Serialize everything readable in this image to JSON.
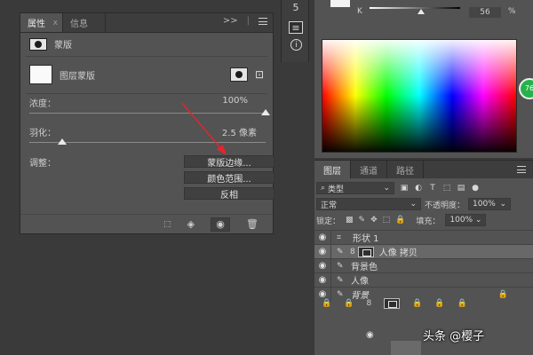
{
  "properties": {
    "tabs": [
      {
        "label": "属性",
        "close": "x"
      },
      {
        "label": "信息"
      }
    ],
    "tab_tools": {
      "collapse": ">>",
      "sep": "|"
    },
    "mask_section_label": "蒙版",
    "layer_mask_label": "图层蒙版",
    "density": {
      "label": "浓度：",
      "value": "100%",
      "level_percent": 100
    },
    "feather": {
      "label": "羽化：",
      "value": "2.5 像素",
      "level_percent": 14
    },
    "adjust_label": "调整：",
    "buttons": {
      "mask_edge": "蒙版边缘...",
      "color_range": "颜色范围...",
      "invert": "反相"
    },
    "footer_icons": [
      "selection-icon",
      "apply-mask-icon",
      "visibility-icon",
      "delete-icon"
    ]
  },
  "tool_strip": {
    "icons": [
      "history-icon",
      "properties-panel-icon",
      "info-icon"
    ],
    "history_glyph": "5",
    "info_glyph": "i"
  },
  "color": {
    "channel_label": "K",
    "channel_value": "56",
    "channel_unit": "%",
    "badge_text": "76"
  },
  "layers": {
    "tabs": [
      "图层",
      "通道",
      "路径"
    ],
    "filter_kind": "类型",
    "blend_mode": "正常",
    "opacity_label": "不透明度：",
    "opacity_value": "100%",
    "lock_label": "锁定：",
    "fill_label": "填充：",
    "fill_value": "100%",
    "rows": [
      {
        "name": "形状 1",
        "type": "shape",
        "selected": false
      },
      {
        "name": "人像 拷贝",
        "type": "masked",
        "selected": true
      },
      {
        "name": "背景色",
        "type": "pixel",
        "selected": false
      },
      {
        "name": "人像",
        "type": "pixel",
        "selected": false
      },
      {
        "name": "背景",
        "type": "background",
        "selected": false
      }
    ]
  },
  "watermark": "头条 @樱子",
  "colors": {
    "panel_bg": "#535353",
    "tab_bg": "#3d3d3d",
    "arrow": "#e8232b",
    "badge_green": "#26b24b"
  }
}
